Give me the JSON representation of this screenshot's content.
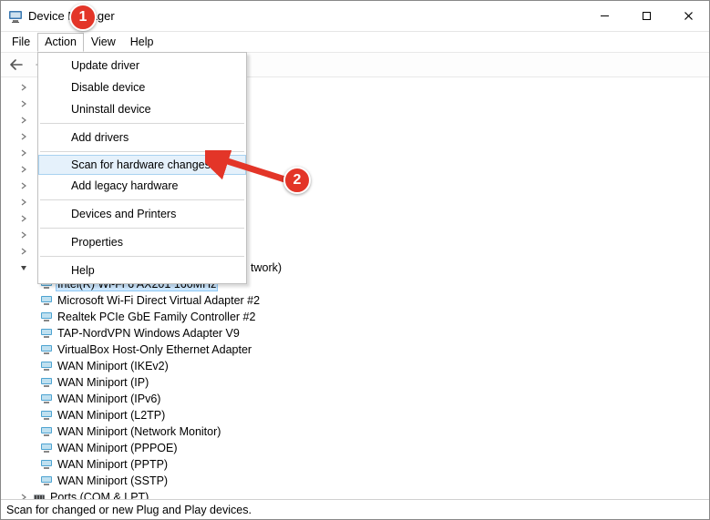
{
  "window": {
    "title": "Device Manager"
  },
  "menubar": {
    "file": "File",
    "action": "Action",
    "view": "View",
    "help": "Help"
  },
  "action_menu": {
    "update_driver": "Update driver",
    "disable_device": "Disable device",
    "uninstall_device": "Uninstall device",
    "add_drivers": "Add drivers",
    "scan_hardware": "Scan for hardware changes",
    "add_legacy": "Add legacy hardware",
    "devices_printers": "Devices and Printers",
    "properties": "Properties",
    "help": "Help"
  },
  "tree": {
    "network_suffix": "twork)",
    "adapters": [
      "Intel(R) Wi-Fi 6 AX201 160MHz",
      "Microsoft Wi-Fi Direct Virtual Adapter #2",
      "Realtek PCIe GbE Family Controller #2",
      "TAP-NordVPN Windows Adapter V9",
      "VirtualBox Host-Only Ethernet Adapter",
      "WAN Miniport (IKEv2)",
      "WAN Miniport (IP)",
      "WAN Miniport (IPv6)",
      "WAN Miniport (L2TP)",
      "WAN Miniport (Network Monitor)",
      "WAN Miniport (PPPOE)",
      "WAN Miniport (PPTP)",
      "WAN Miniport (SSTP)"
    ],
    "ports_label": "Ports (COM & LPT)"
  },
  "statusbar": {
    "text": "Scan for changed or new Plug and Play devices."
  },
  "annotations": {
    "step1": "1",
    "step2": "2"
  },
  "colors": {
    "accent": "#e33528",
    "select_bg": "#cde8ff"
  }
}
